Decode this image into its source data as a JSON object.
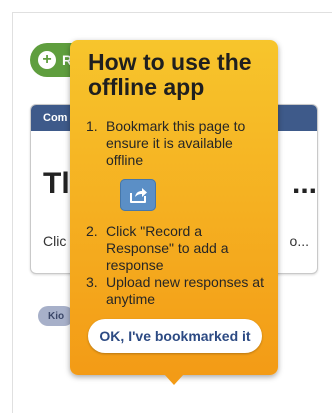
{
  "background": {
    "record_button_label": "R",
    "survey_card": {
      "header": "Com",
      "title_start": "Tl",
      "title_end": "...",
      "description_start": "Clic",
      "description_end": "o..."
    },
    "kiosk_chip": "Kio"
  },
  "popup": {
    "title": "How to use the offline app",
    "steps": [
      {
        "number": "1.",
        "text": "Bookmark this page to ensure it is available offline"
      },
      {
        "number": "2.",
        "text": "Click \"Record a Response\" to add a response"
      },
      {
        "number": "3.",
        "text": "Upload new responses at anytime"
      }
    ],
    "share_icon": "share-icon",
    "ok_button": "OK, I've bookmarked it"
  },
  "colors": {
    "popup_top": "#f7c52c",
    "popup_bottom": "#f39b16",
    "record_button": "#5f9e3e",
    "card_header": "#3e5a8a",
    "ok_text": "#2c4a83"
  }
}
